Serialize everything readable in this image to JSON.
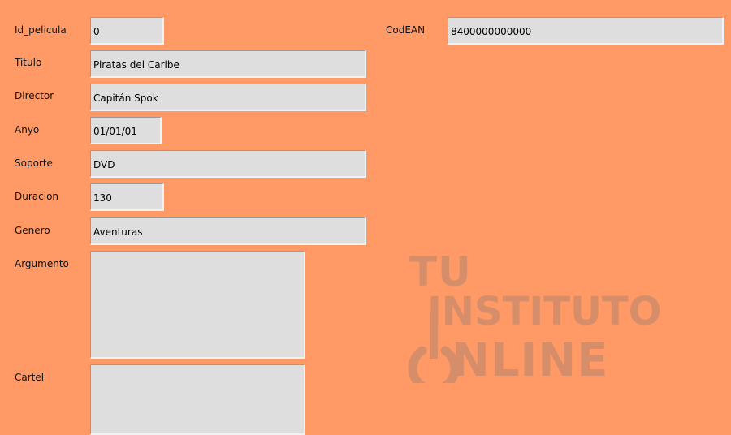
{
  "form": {
    "id_pelicula": {
      "label": "Id_pelicula",
      "value": "0"
    },
    "titulo": {
      "label": "Titulo",
      "value": "Piratas del Caribe"
    },
    "director": {
      "label": "Director",
      "value": "Capitán Spok"
    },
    "anyo": {
      "label": "Anyo",
      "value": "01/01/01"
    },
    "soporte": {
      "label": "Soporte",
      "value": "DVD"
    },
    "duracion": {
      "label": "Duracion",
      "value": "130"
    },
    "genero": {
      "label": "Genero",
      "value": "Aventuras"
    },
    "argumento": {
      "label": "Argumento",
      "value": ""
    },
    "cartel": {
      "label": "Cartel",
      "value": ""
    },
    "codean": {
      "label": "CodEAN",
      "value": "8400000000000"
    }
  },
  "watermark": {
    "line1": "TU",
    "line2": "INSTITUTO",
    "line3": "NLINE",
    "icon": "power-icon"
  },
  "colors": {
    "background": "#ff9966",
    "field": "#dedede",
    "watermark": "#c98a6a"
  }
}
